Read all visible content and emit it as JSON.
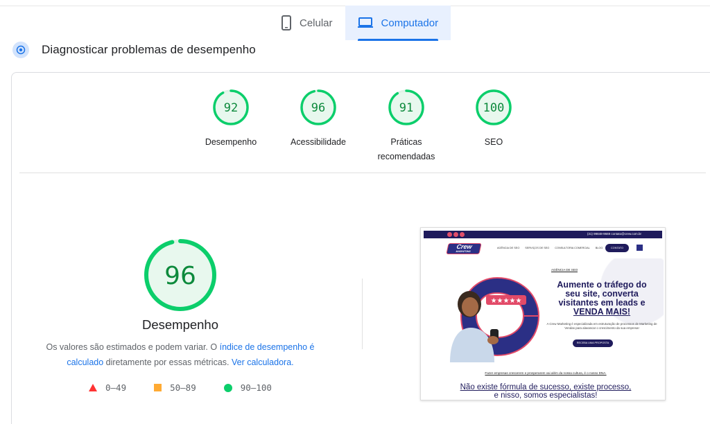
{
  "tabs": [
    {
      "label": "Celular",
      "icon": "smartphone-icon",
      "active": false
    },
    {
      "label": "Computador",
      "icon": "laptop-icon",
      "active": true
    }
  ],
  "diagnose": {
    "title": "Diagnosticar problemas de desempenho",
    "icon": "diagnose-icon"
  },
  "scores": [
    {
      "label": "Desempenho",
      "value": "92",
      "fraction": 0.92
    },
    {
      "label": "Acessibilidade",
      "value": "96",
      "fraction": 0.96
    },
    {
      "label": "Práticas",
      "label2": "recomendadas",
      "value": "91",
      "fraction": 0.91
    },
    {
      "label": "SEO",
      "value": "100",
      "fraction": 1.0
    }
  ],
  "performance": {
    "value": "96",
    "fraction": 0.96,
    "title": "Desempenho",
    "desc_part1": "Os valores são estimados e podem variar. O ",
    "desc_link1": "índice de desempenho é calculado",
    "desc_part2": " diretamente por essas métricas. ",
    "desc_link2": "Ver calculadora."
  },
  "legend": [
    {
      "range": "0–49",
      "shape": "triangle",
      "color": "#ff3333"
    },
    {
      "range": "50–89",
      "shape": "square",
      "color": "#ffaa33"
    },
    {
      "range": "90–100",
      "shape": "circle",
      "color": "#0cce6b"
    }
  ],
  "colors": {
    "pass": "#0cce6b",
    "pass_text": "#0d8a3c",
    "accent": "#1a73e8"
  },
  "screenshot": {
    "top_info": "(31) 99848-9669   contato@crew.com.br",
    "logo_main": "Crew",
    "logo_sub": "MARKETING",
    "menu": [
      "AGÊNCIA DE SEO",
      "SERVIÇOS DE SEO",
      "CONSULTORIA COMERCIAL",
      "BLOG"
    ],
    "cta": "CONTATO",
    "tag": "AGÊNCIA DE SEO",
    "hero_line1": "Aumente o tráfego do",
    "hero_line2": "seu site, converta",
    "hero_line3": "visitantes em leads e",
    "hero_line4": "VENDA MAIS!",
    "sub": "A Crew Marketing é especializada em estruturação de processos de Marketing de Vendas para alavancar o crescimento da sua empresa!",
    "button": "RECEBA UMA PROPOSTA",
    "bottom1": "Fazer empresas crescerem e prosperarem vai além da nossa cultura, é o nosso DNA.",
    "bottom2_line1": "Não existe fórmula de sucesso, existe processo,",
    "bottom2_line2": "e nisso, somos especialistas!"
  }
}
